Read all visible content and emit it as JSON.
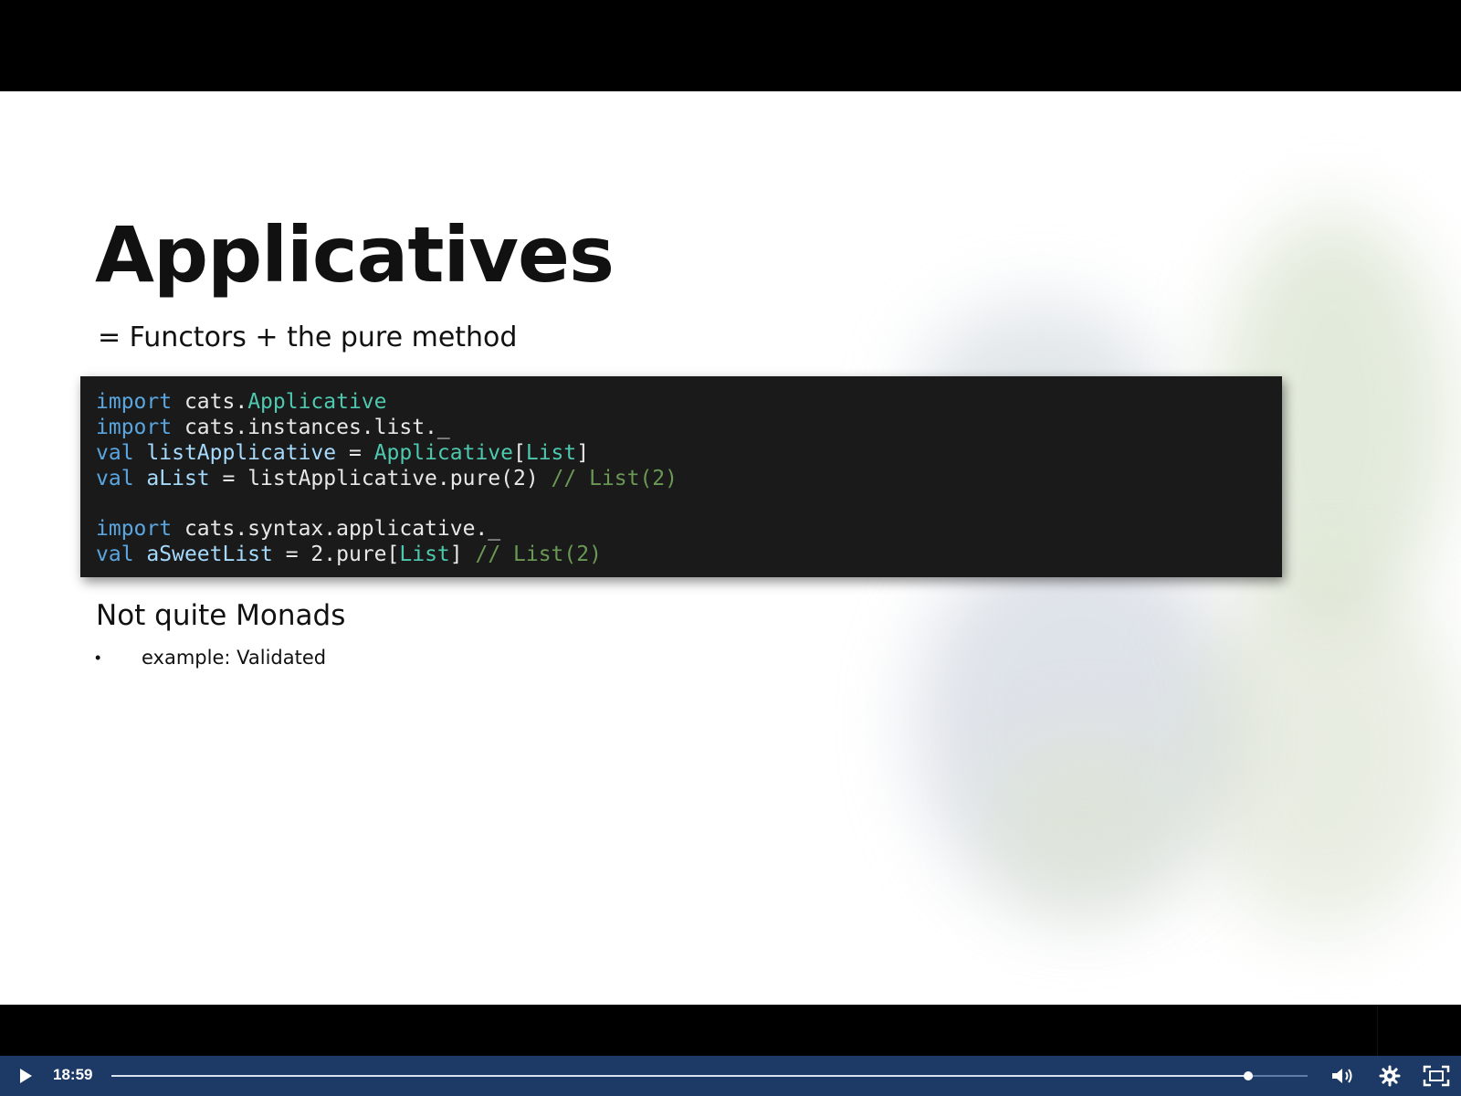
{
  "slide": {
    "title": "Applicatives",
    "subtitle": "= Functors + the pure method",
    "code": {
      "l1": {
        "kw": "import",
        "rest": " cats.",
        "type": "Applicative"
      },
      "l2": {
        "kw": "import",
        "rest": " cats.instances.list._"
      },
      "l3": {
        "kw": "val",
        "sp": " ",
        "name": "listApplicative",
        "eq": " = ",
        "type": "Applicative",
        "lb": "[",
        "type2": "List",
        "rb": "]"
      },
      "l4": {
        "kw": "val",
        "sp": " ",
        "name": "aList",
        "rest": " = listApplicative.pure(2) ",
        "comment": "// List(2)"
      },
      "l5": {
        "kw": "import",
        "rest": " cats.syntax.applicative._"
      },
      "l6": {
        "kw": "val",
        "sp": " ",
        "name": "aSweetList",
        "rest": " = 2.pure[",
        "type": "List",
        "rb": "] ",
        "comment": "// List(2)"
      }
    },
    "section_heading": "Not quite Monads",
    "bullet_marker": "•",
    "bullet_text": "example: Validated"
  },
  "player": {
    "time": "18:59",
    "progress": 0.95,
    "icons": {
      "play": "play-icon",
      "volume": "volume-icon",
      "settings": "gear-icon",
      "fullscreen": "fullscreen-icon"
    },
    "colors": {
      "bar": "#1d3a66",
      "track": "#5f7da6",
      "fill": "#d9e2ee"
    }
  }
}
